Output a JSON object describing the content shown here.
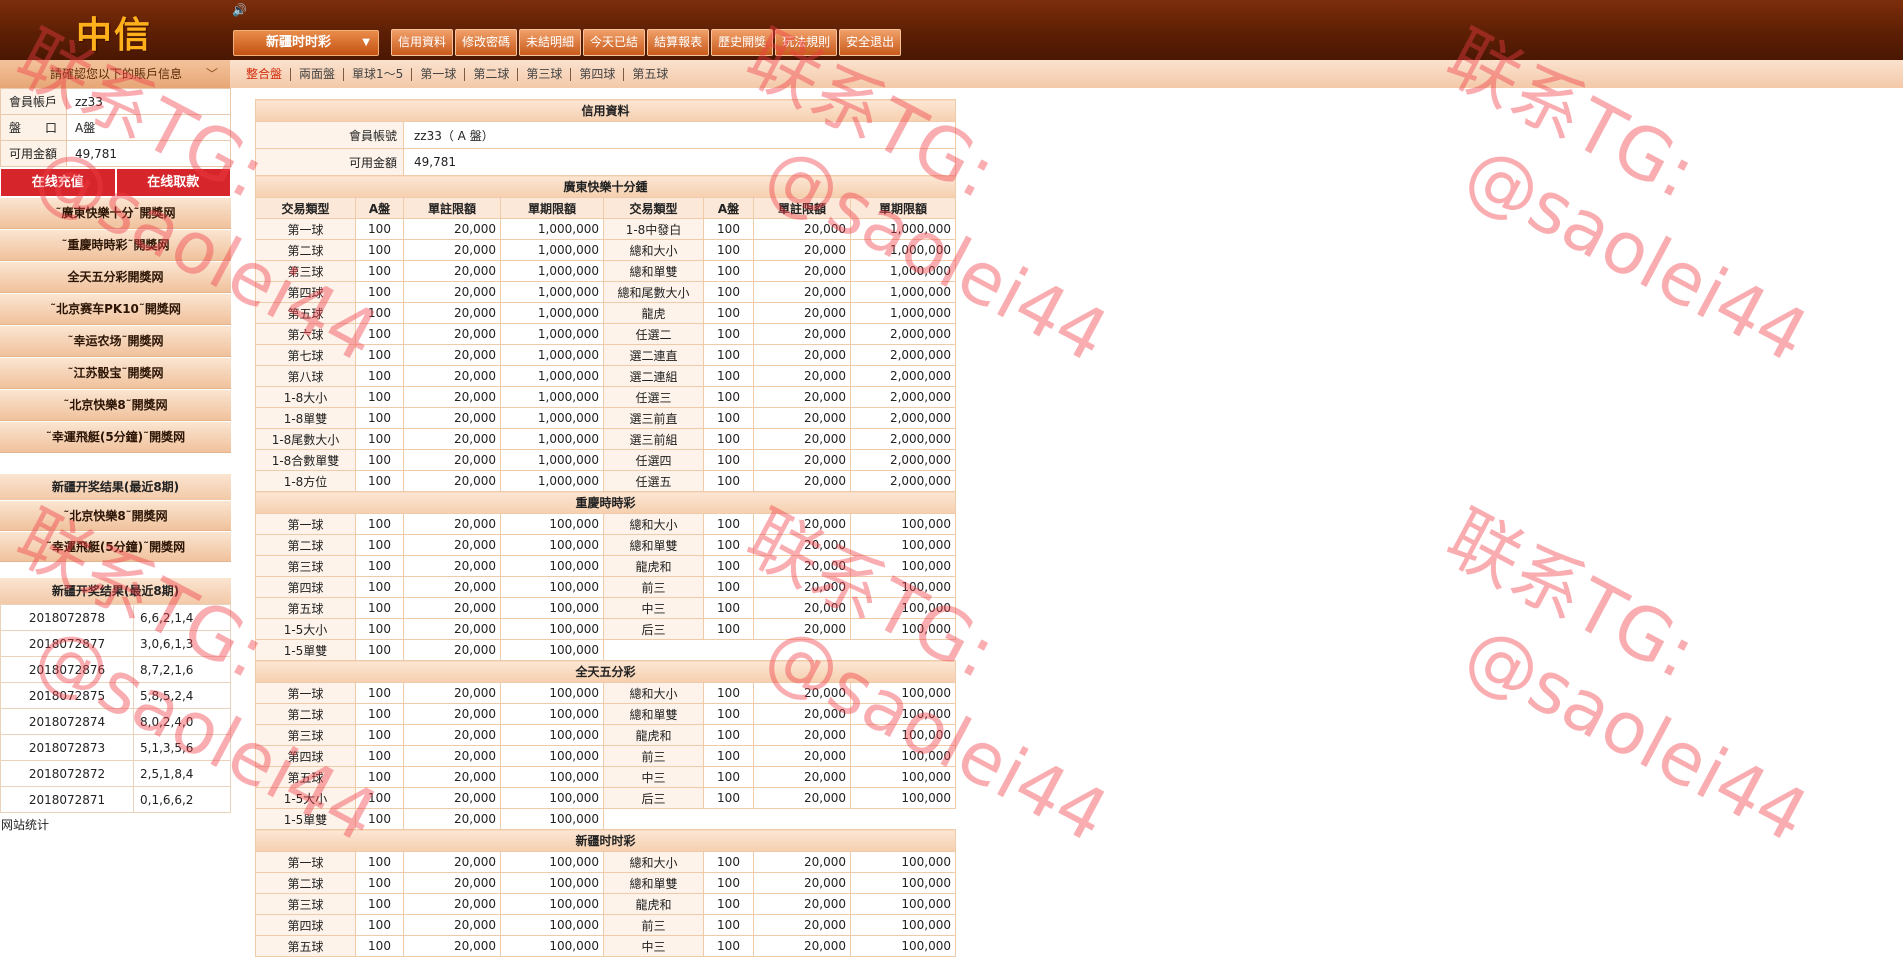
{
  "header": {
    "logo": "中信",
    "speaker": "🔊",
    "lottery_select": "新疆时时彩",
    "nav": [
      "信用資料",
      "修改密碼",
      "未結明細",
      "今天已結",
      "結算報表",
      "歷史開獎",
      "玩法規則",
      "安全退出"
    ]
  },
  "subbar": {
    "account_toggle": "請確認您以下的賬戶信息",
    "tabs": [
      "整合盤",
      "兩面盤",
      "單球1～5",
      "第一球",
      "第二球",
      "第三球",
      "第四球",
      "第五球"
    ]
  },
  "sidebar": {
    "account": [
      {
        "label": "會員帳戶",
        "value": "zz33"
      },
      {
        "label": "盤　　口",
        "value": "A盤"
      },
      {
        "label": "可用金額",
        "value": "49,781"
      }
    ],
    "deposit": "在线充值",
    "withdraw": "在线取款",
    "links": [
      "˜廣東快樂十分˜開獎网",
      "˜重慶時時彩˜開獎网",
      "全天五分彩開獎网",
      "˜北京赛车PK10˜開獎网",
      "˜幸运农场˜開獎网",
      "˜江苏骰宝˜開獎网",
      "˜北京快樂8˜開獎网",
      "˜幸運飛艇(5分鐘)˜開獎网"
    ],
    "box1_title": "新疆开奖结果(最近8期)",
    "box1_links": [
      "˜北京快樂8˜開獎网",
      "˜幸運飛艇(5分鐘)˜開獎网"
    ],
    "box2_title": "新疆开奖结果(最近8期)",
    "results": [
      [
        "2018072878",
        "6,6,2,1,4"
      ],
      [
        "2018072877",
        "3,0,6,1,3"
      ],
      [
        "2018072876",
        "8,7,2,1,6"
      ],
      [
        "2018072875",
        "5,8,5,2,4"
      ],
      [
        "2018072874",
        "8,0,2,4,0"
      ],
      [
        "2018072873",
        "5,1,3,5,6"
      ],
      [
        "2018072872",
        "2,5,1,8,4"
      ],
      [
        "2018072871",
        "0,1,6,6,2"
      ]
    ],
    "site_stat": "网站统计"
  },
  "main": {
    "credit_title": "信用資料",
    "credit_rows": [
      {
        "label": "會員帳號",
        "value": "zz33（ A 盤）"
      },
      {
        "label": "可用金額",
        "value": "49,781"
      }
    ],
    "col_headers": [
      "交易類型",
      "A盤",
      "單註限額",
      "單期限額",
      "交易類型",
      "A盤",
      "單註限額",
      "單期限額"
    ],
    "sections": [
      {
        "title": "廣東快樂十分鍾",
        "show_cols": true,
        "rows": [
          [
            "第一球",
            "100",
            "20,000",
            "1,000,000",
            "1-8中發白",
            "100",
            "20,000",
            "1,000,000"
          ],
          [
            "第二球",
            "100",
            "20,000",
            "1,000,000",
            "總和大小",
            "100",
            "20,000",
            "1,000,000"
          ],
          [
            "第三球",
            "100",
            "20,000",
            "1,000,000",
            "總和單雙",
            "100",
            "20,000",
            "1,000,000"
          ],
          [
            "第四球",
            "100",
            "20,000",
            "1,000,000",
            "總和尾數大小",
            "100",
            "20,000",
            "1,000,000"
          ],
          [
            "第五球",
            "100",
            "20,000",
            "1,000,000",
            "龍虎",
            "100",
            "20,000",
            "1,000,000"
          ],
          [
            "第六球",
            "100",
            "20,000",
            "1,000,000",
            "任選二",
            "100",
            "20,000",
            "2,000,000"
          ],
          [
            "第七球",
            "100",
            "20,000",
            "1,000,000",
            "選二連直",
            "100",
            "20,000",
            "2,000,000"
          ],
          [
            "第八球",
            "100",
            "20,000",
            "1,000,000",
            "選二連組",
            "100",
            "20,000",
            "2,000,000"
          ],
          [
            "1-8大小",
            "100",
            "20,000",
            "1,000,000",
            "任選三",
            "100",
            "20,000",
            "2,000,000"
          ],
          [
            "1-8單雙",
            "100",
            "20,000",
            "1,000,000",
            "選三前直",
            "100",
            "20,000",
            "2,000,000"
          ],
          [
            "1-8尾數大小",
            "100",
            "20,000",
            "1,000,000",
            "選三前組",
            "100",
            "20,000",
            "2,000,000"
          ],
          [
            "1-8合數單雙",
            "100",
            "20,000",
            "1,000,000",
            "任選四",
            "100",
            "20,000",
            "2,000,000"
          ],
          [
            "1-8方位",
            "100",
            "20,000",
            "1,000,000",
            "任選五",
            "100",
            "20,000",
            "2,000,000"
          ]
        ]
      },
      {
        "title": "重慶時時彩",
        "show_cols": false,
        "rows": [
          [
            "第一球",
            "100",
            "20,000",
            "100,000",
            "總和大小",
            "100",
            "20,000",
            "100,000"
          ],
          [
            "第二球",
            "100",
            "20,000",
            "100,000",
            "總和單雙",
            "100",
            "20,000",
            "100,000"
          ],
          [
            "第三球",
            "100",
            "20,000",
            "100,000",
            "龍虎和",
            "100",
            "20,000",
            "100,000"
          ],
          [
            "第四球",
            "100",
            "20,000",
            "100,000",
            "前三",
            "100",
            "20,000",
            "100,000"
          ],
          [
            "第五球",
            "100",
            "20,000",
            "100,000",
            "中三",
            "100",
            "20,000",
            "100,000"
          ],
          [
            "1-5大小",
            "100",
            "20,000",
            "100,000",
            "后三",
            "100",
            "20,000",
            "100,000"
          ],
          [
            "1-5單雙",
            "100",
            "20,000",
            "100,000",
            "",
            "",
            "",
            ""
          ]
        ]
      },
      {
        "title": "全天五分彩",
        "show_cols": false,
        "rows": [
          [
            "第一球",
            "100",
            "20,000",
            "100,000",
            "總和大小",
            "100",
            "20,000",
            "100,000"
          ],
          [
            "第二球",
            "100",
            "20,000",
            "100,000",
            "總和單雙",
            "100",
            "20,000",
            "100,000"
          ],
          [
            "第三球",
            "100",
            "20,000",
            "100,000",
            "龍虎和",
            "100",
            "20,000",
            "100,000"
          ],
          [
            "第四球",
            "100",
            "20,000",
            "100,000",
            "前三",
            "100",
            "20,000",
            "100,000"
          ],
          [
            "第五球",
            "100",
            "20,000",
            "100,000",
            "中三",
            "100",
            "20,000",
            "100,000"
          ],
          [
            "1-5大小",
            "100",
            "20,000",
            "100,000",
            "后三",
            "100",
            "20,000",
            "100,000"
          ],
          [
            "1-5單雙",
            "100",
            "20,000",
            "100,000",
            "",
            "",
            "",
            ""
          ]
        ]
      },
      {
        "title": "新疆时时彩",
        "show_cols": false,
        "rows": [
          [
            "第一球",
            "100",
            "20,000",
            "100,000",
            "總和大小",
            "100",
            "20,000",
            "100,000"
          ],
          [
            "第二球",
            "100",
            "20,000",
            "100,000",
            "總和單雙",
            "100",
            "20,000",
            "100,000"
          ],
          [
            "第三球",
            "100",
            "20,000",
            "100,000",
            "龍虎和",
            "100",
            "20,000",
            "100,000"
          ],
          [
            "第四球",
            "100",
            "20,000",
            "100,000",
            "前三",
            "100",
            "20,000",
            "100,000"
          ],
          [
            "第五球",
            "100",
            "20,000",
            "100,000",
            "中三",
            "100",
            "20,000",
            "100,000"
          ]
        ]
      }
    ]
  },
  "watermark": {
    "line1": "联系TG:",
    "line2": "@saolei44"
  }
}
